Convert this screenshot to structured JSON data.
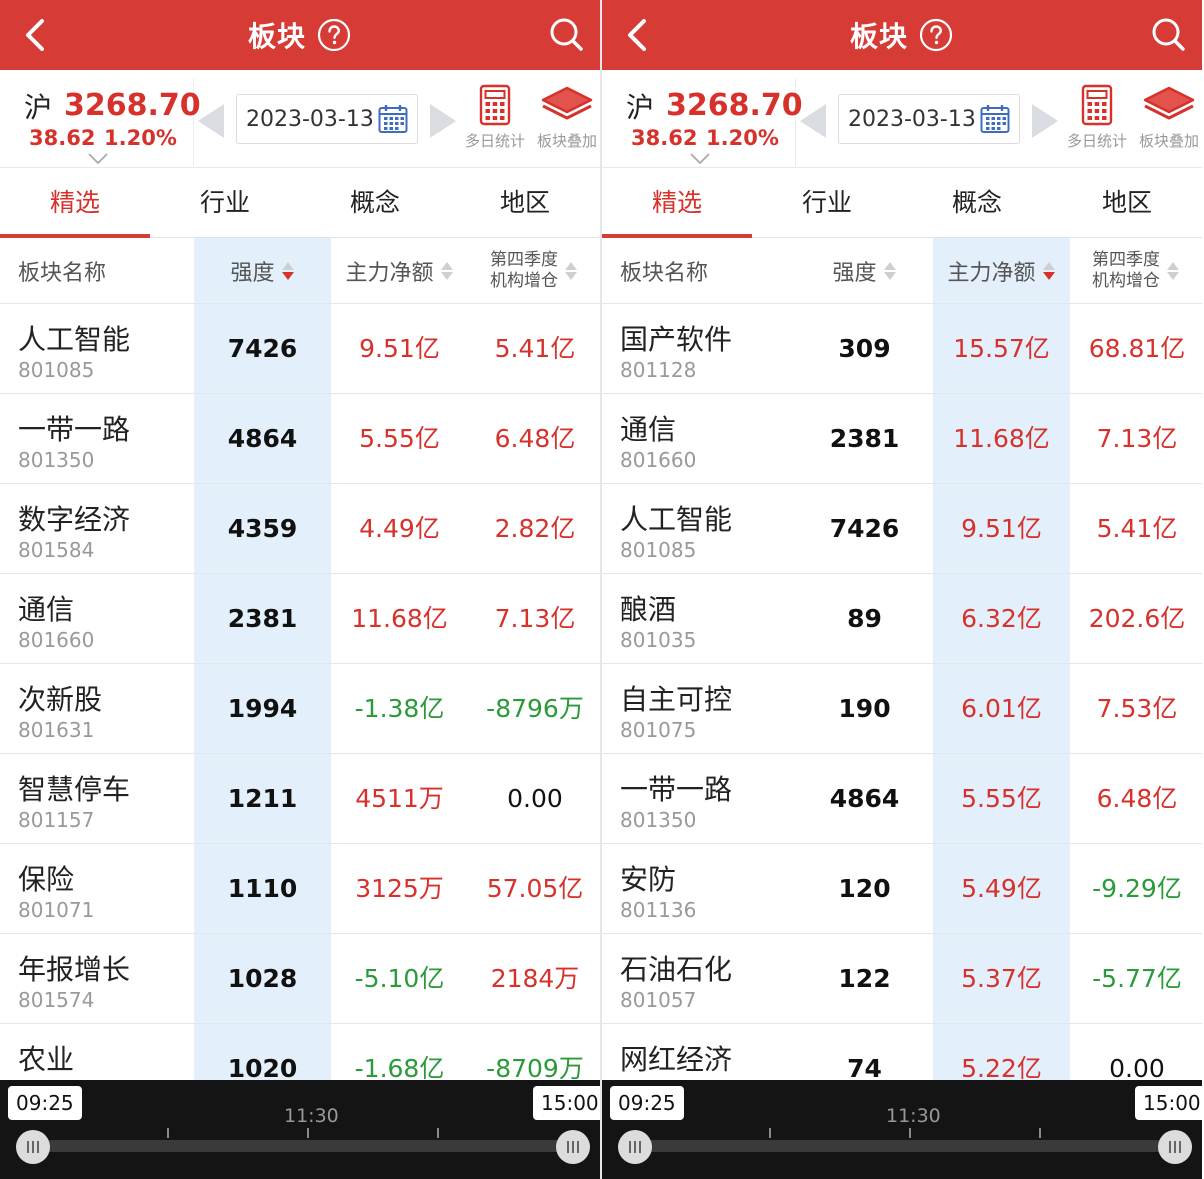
{
  "colors": {
    "header": "#d73b36",
    "up": "#d7312b",
    "down": "#2a9a3a",
    "highlight": "#e3f0fb"
  },
  "panels": [
    {
      "header": {
        "title": "板块"
      },
      "index": {
        "name": "沪",
        "value": "3268.70",
        "change": "38.62",
        "percent": "1.20%"
      },
      "date": "2023-03-13",
      "tools": {
        "multi_day": "多日统计",
        "overlay": "板块叠加"
      },
      "tabs": [
        "精选",
        "行业",
        "概念",
        "地区"
      ],
      "active_tab": 0,
      "columns": {
        "name": "板块名称",
        "strength": "强度",
        "fund": "主力净额",
        "q4_line1": "第四季度",
        "q4_line2": "机构增仓"
      },
      "sorted_column": "strength",
      "rows": [
        {
          "name": "人工智能",
          "code": "801085",
          "strength": "7426",
          "fund": "9.51亿",
          "q4": "5.41亿",
          "fund_dir": "pos",
          "q4_dir": "pos"
        },
        {
          "name": "一带一路",
          "code": "801350",
          "strength": "4864",
          "fund": "5.55亿",
          "q4": "6.48亿",
          "fund_dir": "pos",
          "q4_dir": "pos"
        },
        {
          "name": "数字经济",
          "code": "801584",
          "strength": "4359",
          "fund": "4.49亿",
          "q4": "2.82亿",
          "fund_dir": "pos",
          "q4_dir": "pos"
        },
        {
          "name": "通信",
          "code": "801660",
          "strength": "2381",
          "fund": "11.68亿",
          "q4": "7.13亿",
          "fund_dir": "pos",
          "q4_dir": "pos"
        },
        {
          "name": "次新股",
          "code": "801631",
          "strength": "1994",
          "fund": "-1.38亿",
          "q4": "-8796万",
          "fund_dir": "neg",
          "q4_dir": "neg"
        },
        {
          "name": "智慧停车",
          "code": "801157",
          "strength": "1211",
          "fund": "4511万",
          "q4": "0.00",
          "fund_dir": "pos",
          "q4_dir": "flat"
        },
        {
          "name": "保险",
          "code": "801071",
          "strength": "1110",
          "fund": "3125万",
          "q4": "57.05亿",
          "fund_dir": "pos",
          "q4_dir": "pos"
        },
        {
          "name": "年报增长",
          "code": "801574",
          "strength": "1028",
          "fund": "-5.10亿",
          "q4": "2184万",
          "fund_dir": "neg",
          "q4_dir": "pos"
        },
        {
          "name": "农业",
          "code": "",
          "strength": "1020",
          "fund": "-1.68亿",
          "q4": "-8709万",
          "fund_dir": "neg",
          "q4_dir": "neg"
        }
      ],
      "timebar": {
        "start": "09:25",
        "mid": "11:30",
        "end": "15:00"
      }
    },
    {
      "header": {
        "title": "板块"
      },
      "index": {
        "name": "沪",
        "value": "3268.70",
        "change": "38.62",
        "percent": "1.20%"
      },
      "date": "2023-03-13",
      "tools": {
        "multi_day": "多日统计",
        "overlay": "板块叠加"
      },
      "tabs": [
        "精选",
        "行业",
        "概念",
        "地区"
      ],
      "active_tab": 0,
      "columns": {
        "name": "板块名称",
        "strength": "强度",
        "fund": "主力净额",
        "q4_line1": "第四季度",
        "q4_line2": "机构增仓"
      },
      "sorted_column": "fund",
      "rows": [
        {
          "name": "国产软件",
          "code": "801128",
          "strength": "309",
          "fund": "15.57亿",
          "q4": "68.81亿",
          "fund_dir": "pos",
          "q4_dir": "pos"
        },
        {
          "name": "通信",
          "code": "801660",
          "strength": "2381",
          "fund": "11.68亿",
          "q4": "7.13亿",
          "fund_dir": "pos",
          "q4_dir": "pos"
        },
        {
          "name": "人工智能",
          "code": "801085",
          "strength": "7426",
          "fund": "9.51亿",
          "q4": "5.41亿",
          "fund_dir": "pos",
          "q4_dir": "pos"
        },
        {
          "name": "酿酒",
          "code": "801035",
          "strength": "89",
          "fund": "6.32亿",
          "q4": "202.6亿",
          "fund_dir": "pos",
          "q4_dir": "pos"
        },
        {
          "name": "自主可控",
          "code": "801075",
          "strength": "190",
          "fund": "6.01亿",
          "q4": "7.53亿",
          "fund_dir": "pos",
          "q4_dir": "pos"
        },
        {
          "name": "一带一路",
          "code": "801350",
          "strength": "4864",
          "fund": "5.55亿",
          "q4": "6.48亿",
          "fund_dir": "pos",
          "q4_dir": "pos"
        },
        {
          "name": "安防",
          "code": "801136",
          "strength": "120",
          "fund": "5.49亿",
          "q4": "-9.29亿",
          "fund_dir": "pos",
          "q4_dir": "neg"
        },
        {
          "name": "石油石化",
          "code": "801057",
          "strength": "122",
          "fund": "5.37亿",
          "q4": "-5.77亿",
          "fund_dir": "pos",
          "q4_dir": "neg"
        },
        {
          "name": "网红经济",
          "code": "",
          "strength": "74",
          "fund": "5.22亿",
          "q4": "0.00",
          "fund_dir": "pos",
          "q4_dir": "flat"
        }
      ],
      "timebar": {
        "start": "09:25",
        "mid": "11:30",
        "end": "15:00"
      }
    }
  ]
}
